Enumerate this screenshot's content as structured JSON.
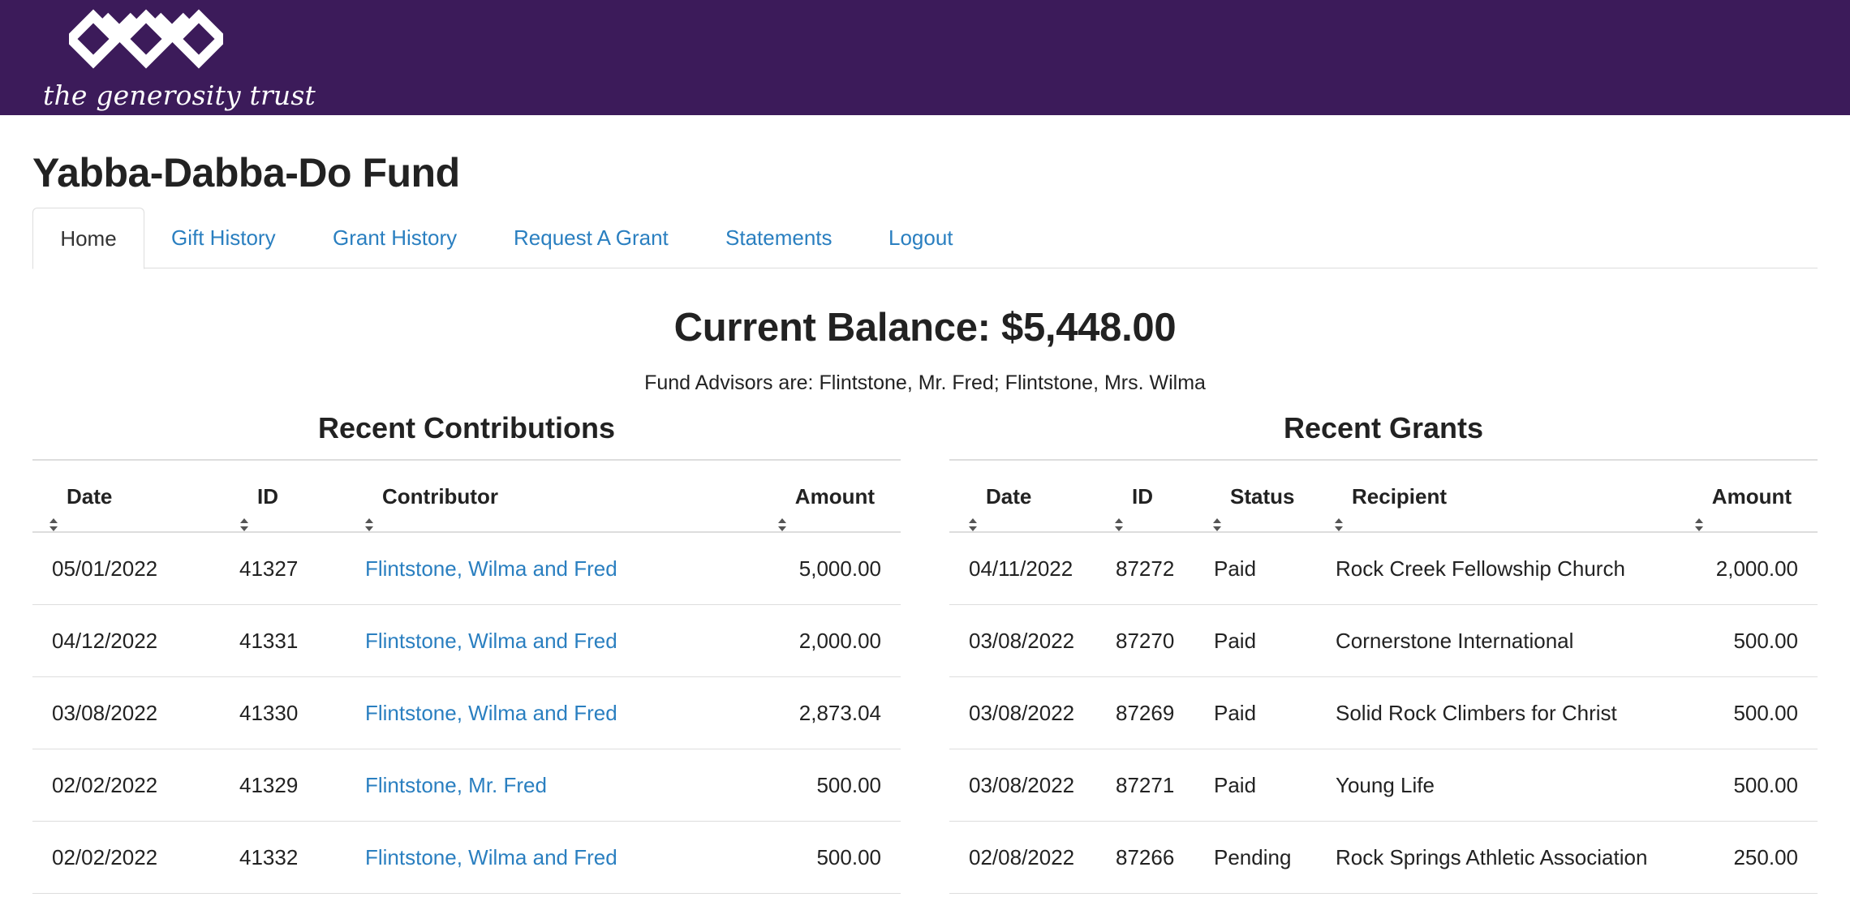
{
  "brand": {
    "name": "the generosity trust",
    "bg_color": "#3c1b5a",
    "logo_icon": "diamond-chain-logo"
  },
  "page": {
    "title": "Yabba-Dabba-Do Fund"
  },
  "tabs": [
    {
      "label": "Home",
      "active": true
    },
    {
      "label": "Gift History"
    },
    {
      "label": "Grant History"
    },
    {
      "label": "Request A Grant"
    },
    {
      "label": "Statements"
    },
    {
      "label": "Logout"
    }
  ],
  "summary": {
    "balance": "Current Balance: $5,448.00",
    "advisors": "Fund Advisors are: Flintstone, Mr. Fred; Flintstone, Mrs. Wilma"
  },
  "contributions": {
    "title": "Recent Contributions",
    "headers": {
      "date": "Date",
      "id": "ID",
      "contributor": "Contributor",
      "amount": "Amount"
    },
    "rows": [
      {
        "date": "05/01/2022",
        "id": "41327",
        "contributor": "Flintstone, Wilma and Fred",
        "amount": "5,000.00"
      },
      {
        "date": "04/12/2022",
        "id": "41331",
        "contributor": "Flintstone, Wilma and Fred",
        "amount": "2,000.00"
      },
      {
        "date": "03/08/2022",
        "id": "41330",
        "contributor": "Flintstone, Wilma and Fred",
        "amount": "2,873.04"
      },
      {
        "date": "02/02/2022",
        "id": "41329",
        "contributor": "Flintstone, Mr. Fred",
        "amount": "500.00"
      },
      {
        "date": "02/02/2022",
        "id": "41332",
        "contributor": "Flintstone, Wilma and Fred",
        "amount": "500.00"
      }
    ]
  },
  "grants": {
    "title": "Recent Grants",
    "headers": {
      "date": "Date",
      "id": "ID",
      "status": "Status",
      "recipient": "Recipient",
      "amount": "Amount"
    },
    "rows": [
      {
        "date": "04/11/2022",
        "id": "87272",
        "status": "Paid",
        "recipient": "Rock Creek Fellowship Church",
        "amount": "2,000.00"
      },
      {
        "date": "03/08/2022",
        "id": "87270",
        "status": "Paid",
        "recipient": "Cornerstone International",
        "amount": "500.00"
      },
      {
        "date": "03/08/2022",
        "id": "87269",
        "status": "Paid",
        "recipient": "Solid Rock Climbers for Christ",
        "amount": "500.00"
      },
      {
        "date": "03/08/2022",
        "id": "87271",
        "status": "Paid",
        "recipient": "Young Life",
        "amount": "500.00"
      },
      {
        "date": "02/08/2022",
        "id": "87266",
        "status": "Pending",
        "recipient": "Rock Springs Athletic Association",
        "amount": "250.00"
      }
    ]
  },
  "colors": {
    "link": "#2a7fc0",
    "border": "#dddddd",
    "text": "#222222"
  }
}
